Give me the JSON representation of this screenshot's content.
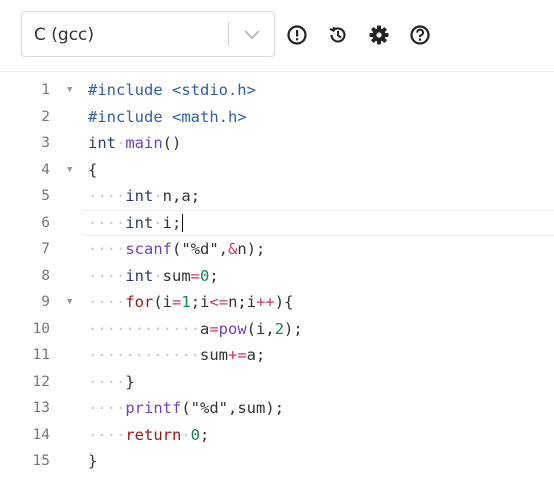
{
  "toolbar": {
    "language": "C (gcc)",
    "icons": [
      "alert-circle-icon",
      "history-icon",
      "gear-icon",
      "help-circle-icon"
    ]
  },
  "editor": {
    "active_line": 6,
    "lines": [
      {
        "n": "1",
        "fold": true
      },
      {
        "n": "2",
        "fold": false
      },
      {
        "n": "3",
        "fold": false
      },
      {
        "n": "4",
        "fold": true
      },
      {
        "n": "5",
        "fold": false
      },
      {
        "n": "6",
        "fold": false
      },
      {
        "n": "7",
        "fold": false
      },
      {
        "n": "8",
        "fold": false
      },
      {
        "n": "9",
        "fold": true
      },
      {
        "n": "10",
        "fold": false
      },
      {
        "n": "11",
        "fold": false
      },
      {
        "n": "12",
        "fold": false
      },
      {
        "n": "13",
        "fold": false
      },
      {
        "n": "14",
        "fold": false
      },
      {
        "n": "15",
        "fold": false
      }
    ],
    "code": [
      "#include <stdio.h>",
      "#include <math.h>",
      "int main()",
      "{",
      "    int n,a;",
      "    int i;",
      "    scanf(\"%d\",&n);",
      "    int sum=0;",
      "    for(i=1;i<=n;i++){",
      "            a=pow(i,2);",
      "            sum+=a;",
      "    }",
      "    printf(\"%d\",sum);",
      "    return 0;",
      "}"
    ]
  }
}
